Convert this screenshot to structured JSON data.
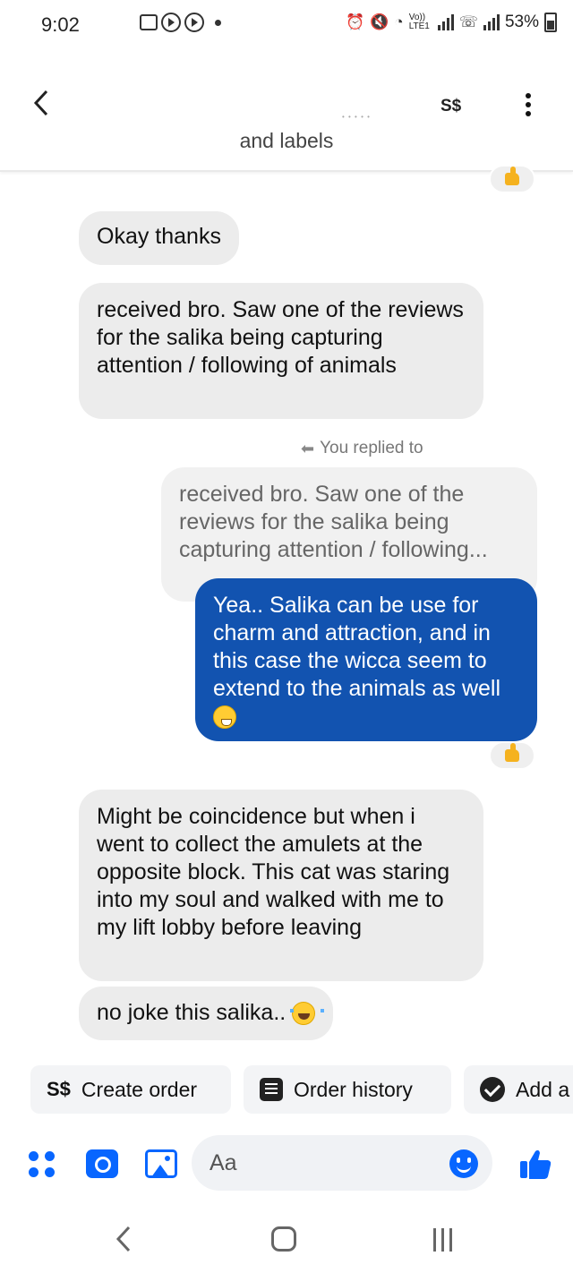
{
  "status_bar": {
    "time": "9:02",
    "volte": "Vo)) LTE1",
    "battery": "53%"
  },
  "header": {
    "currency": "S$",
    "subtitle": "and labels",
    "back_icon": "chevron-left-icon",
    "menu_icon": "more-vertical-icon"
  },
  "messages": [
    {
      "direction": "in",
      "text": "Okay thanks"
    },
    {
      "direction": "in",
      "text": "received bro. Saw one of the reviews for the salika being capturing attention / following of animals"
    },
    {
      "direction": "note",
      "text": "You replied to"
    },
    {
      "direction": "quote",
      "text": "received bro. Saw one of the reviews for the salika being capturing attention / following..."
    },
    {
      "direction": "out",
      "text": "Yea.. Salika can be use for charm and attraction, and in this case the wicca seem to extend to the animals as well",
      "emoji": "grinning-face-icon",
      "reaction": "thumbs-up-icon"
    },
    {
      "direction": "in",
      "text": "Might be coincidence but when i went to collect the amulets at the opposite block. This cat was staring into my soul and walked with me to my lift lobby before leaving"
    },
    {
      "direction": "in",
      "text": "no joke this salika..",
      "emoji": "tears-of-joy-icon"
    }
  ],
  "quick_actions": [
    {
      "icon": "S$",
      "label": "Create order"
    },
    {
      "icon": "list-icon",
      "label": "Order history"
    },
    {
      "icon": "check-circle-icon",
      "label": "Add a"
    }
  ],
  "composer": {
    "placeholder": "Aa"
  },
  "colors": {
    "outgoing_bubble": "#1253b0",
    "incoming_bubble": "#ececec",
    "accent": "#0866ff",
    "reaction": "#f5b21f"
  }
}
